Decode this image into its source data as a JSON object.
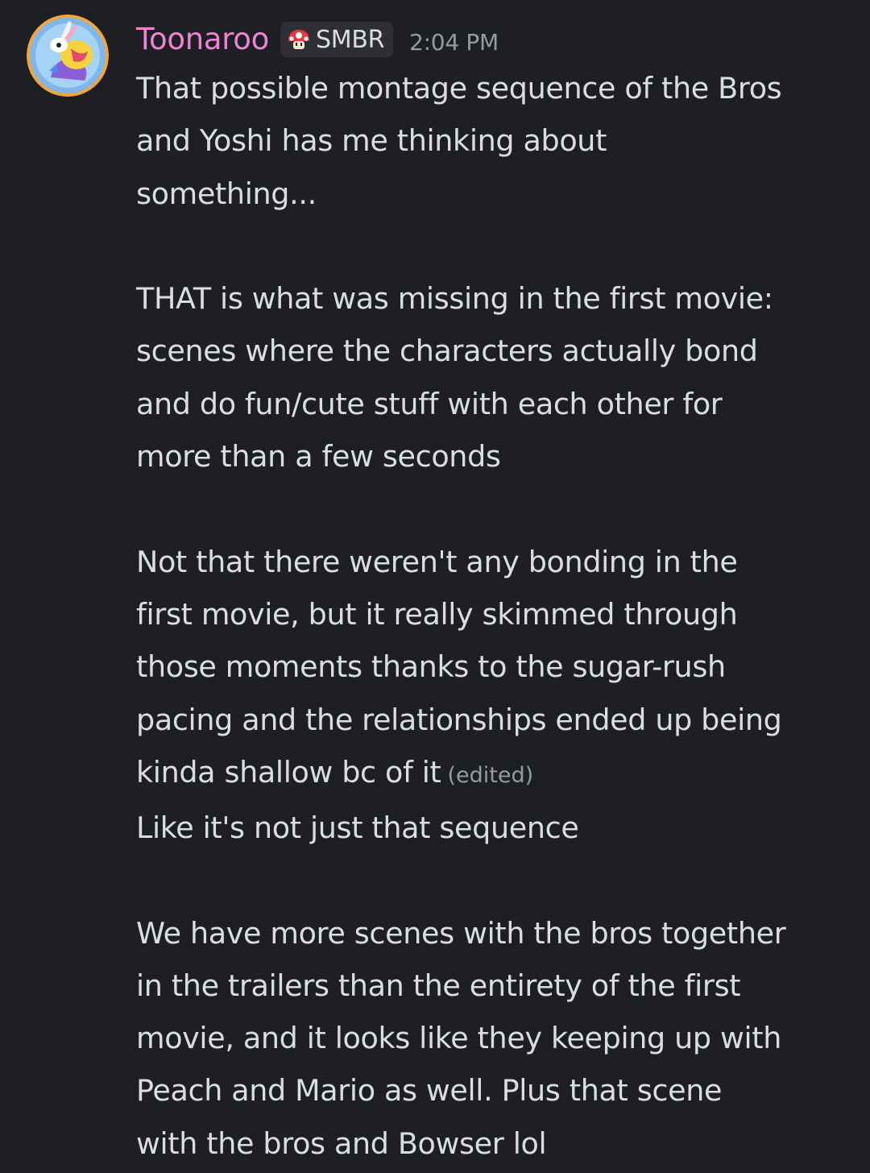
{
  "author": {
    "username": "Toonaroo",
    "username_color": "#ec83d4",
    "role_tag": {
      "icon": "mushroom-icon",
      "label": "SMBR"
    }
  },
  "timestamp": "2:04 PM",
  "message1": {
    "p1": [
      "That possible montage sequence of the Bros",
      "and Yoshi has me thinking about",
      "something..."
    ],
    "p2": [
      "THAT is what was missing in the first movie:",
      "scenes where the characters actually bond",
      "and do fun/cute stuff with each other for",
      "more than a few seconds"
    ],
    "p3": [
      "Not that there weren't any bonding in the",
      "first movie, but it really skimmed through",
      "those moments thanks to the sugar-rush",
      "pacing and the relationships ended up being",
      "kinda shallow bc of it"
    ],
    "edited_label": "(edited)"
  },
  "message2": {
    "p1": [
      "Like it's not just that sequence"
    ],
    "p2": [
      "We have more scenes with the bros together",
      "in the trailers than the entirety of the first",
      "movie, and it looks like they keeping up with",
      "Peach and Mario as well. Plus that scene",
      "with the bros and Bowser lol"
    ]
  },
  "colors": {
    "background": "#1e1f22",
    "text": "#dbdee1",
    "muted": "#949ba4",
    "tag_bg": "#2e2f34"
  }
}
